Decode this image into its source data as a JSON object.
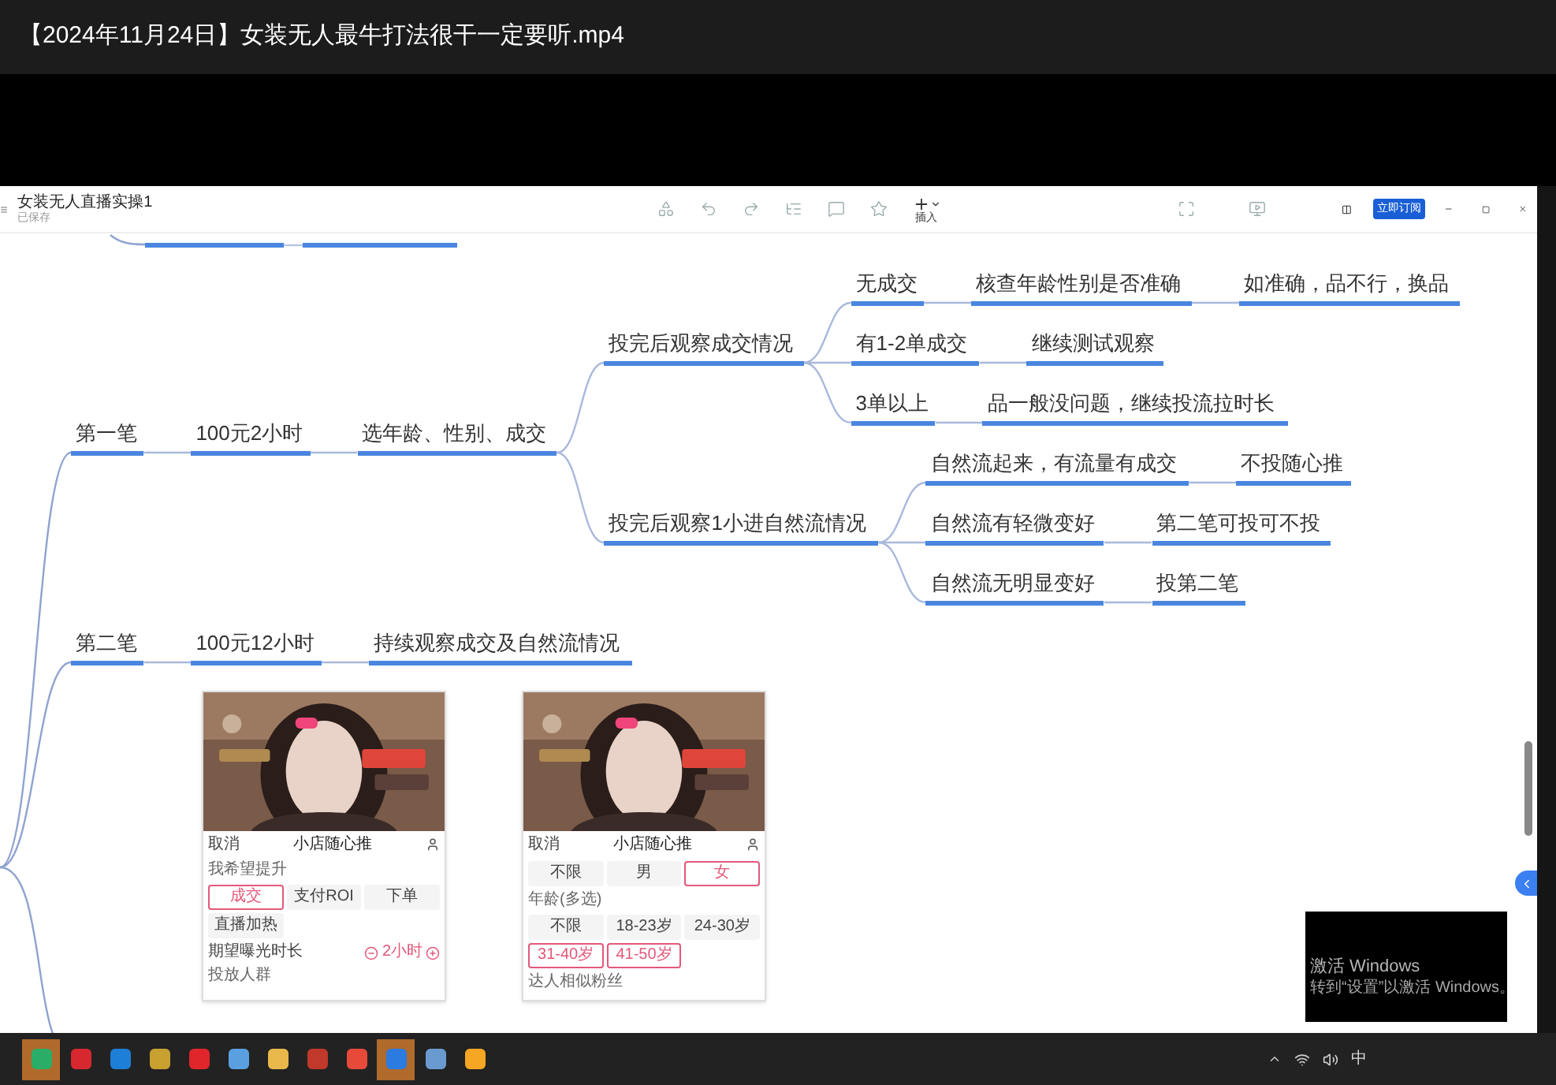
{
  "video_title": "【2024年11月24日】女装无人最牛打法很干一定要听.mp4",
  "app": {
    "doc_title": "女装无人直播实操1",
    "save_status": "已保存",
    "insert_label": "插入",
    "subscribe_button": "立即订阅"
  },
  "mindmap": {
    "nodes": [
      {
        "text": "第一笔",
        "children": [
          {
            "text": "100元2小时",
            "children": [
              {
                "text": "选年龄、性别、成交",
                "children": [
                  {
                    "text": "投完后观察成交情况",
                    "children": [
                      {
                        "text": "无成交",
                        "children": [
                          {
                            "text": "核查年龄性别是否准确",
                            "children": [
                              {
                                "text": "如准确，品不行，换品"
                              }
                            ]
                          }
                        ]
                      },
                      {
                        "text": "有1-2单成交",
                        "children": [
                          {
                            "text": "继续测试观察"
                          }
                        ]
                      },
                      {
                        "text": "3单以上",
                        "children": [
                          {
                            "text": "品一般没问题，继续投流拉时长"
                          }
                        ]
                      }
                    ]
                  },
                  {
                    "text": "投完后观察1小进自然流情况",
                    "children": [
                      {
                        "text": "自然流起来，有流量有成交",
                        "children": [
                          {
                            "text": "不投随心推"
                          }
                        ]
                      },
                      {
                        "text": "自然流有轻微变好",
                        "children": [
                          {
                            "text": "第二笔可投可不投"
                          }
                        ]
                      },
                      {
                        "text": "自然流无明显变好",
                        "children": [
                          {
                            "text": "投第二笔"
                          }
                        ]
                      }
                    ]
                  }
                ]
              }
            ]
          }
        ]
      },
      {
        "text": "第二笔",
        "children": [
          {
            "text": "100元12小时",
            "children": [
              {
                "text": "持续观察成交及自然流情况"
              }
            ]
          }
        ]
      }
    ]
  },
  "phones": [
    {
      "cancel": "取消",
      "title": "小店随心推",
      "sections": [
        {
          "kind": "label",
          "label": "我希望提升"
        },
        {
          "kind": "options",
          "options": [
            {
              "label": "成交",
              "selected": true
            },
            {
              "label": "支付ROI",
              "selected": false
            },
            {
              "label": "下单",
              "selected": false
            },
            {
              "label": "直播加热",
              "selected": false
            }
          ]
        },
        {
          "kind": "stepper",
          "label": "期望曝光时长",
          "value": "2小时"
        },
        {
          "kind": "label",
          "label": "投放人群"
        }
      ]
    },
    {
      "cancel": "取消",
      "title": "小店随心推",
      "sections": [
        {
          "kind": "options",
          "options": [
            {
              "label": "不限",
              "selected": false
            },
            {
              "label": "男",
              "selected": false
            },
            {
              "label": "女",
              "selected": true
            }
          ]
        },
        {
          "kind": "label",
          "label": "年龄(多选)"
        },
        {
          "kind": "options",
          "options": [
            {
              "label": "不限",
              "selected": false
            },
            {
              "label": "18-23岁",
              "selected": false
            },
            {
              "label": "24-30岁",
              "selected": false
            },
            {
              "label": "31-40岁",
              "selected": true
            },
            {
              "label": "41-50岁",
              "selected": true
            }
          ]
        },
        {
          "kind": "label",
          "label": "达人相似粉丝"
        }
      ]
    }
  ],
  "windows_notice": {
    "title": "激活 Windows",
    "hint": "转到“设置”以激活 Windows。"
  },
  "taskbar": {
    "apps": [
      {
        "color": "#2aae67",
        "active": true
      },
      {
        "color": "#d7282f",
        "active": false
      },
      {
        "color": "#1e7fd8",
        "active": false
      },
      {
        "color": "#c8a030",
        "active": false
      },
      {
        "color": "#e0262a",
        "active": false
      },
      {
        "color": "#5aa0e0",
        "active": false
      },
      {
        "color": "#e8b84a",
        "active": false
      },
      {
        "color": "#c0392b",
        "active": false
      },
      {
        "color": "#e84a3a",
        "active": false
      },
      {
        "color": "#2b7be0",
        "active": true
      },
      {
        "color": "#6a9bd0",
        "active": false
      },
      {
        "color": "#f5a623",
        "active": false
      }
    ],
    "ime": "中"
  }
}
